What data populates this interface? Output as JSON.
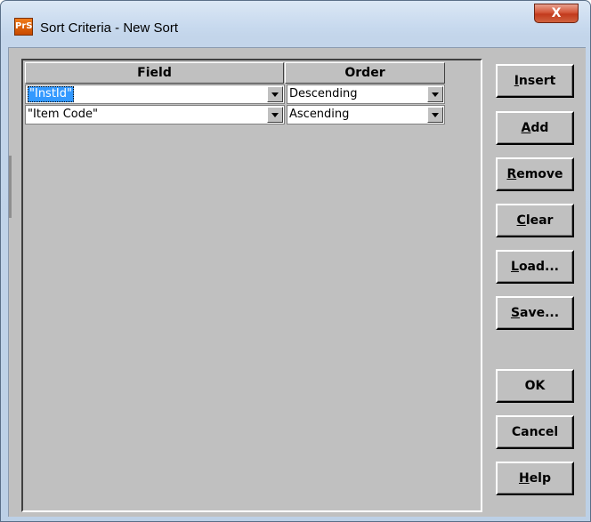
{
  "window": {
    "title": "Sort Criteria - New Sort",
    "icon_text": "PrS",
    "close_glyph": "X"
  },
  "grid": {
    "columns": [
      "Field",
      "Order"
    ],
    "rows": [
      {
        "field": "\"InstId\"",
        "order": "Descending",
        "selected": true
      },
      {
        "field": "\"Item Code\"",
        "order": "Ascending",
        "selected": false
      }
    ]
  },
  "buttons": [
    {
      "key": "insert",
      "label": "Insert",
      "mnemonic_index": 0
    },
    {
      "key": "add",
      "label": "Add",
      "mnemonic_index": 0
    },
    {
      "key": "remove",
      "label": "Remove",
      "mnemonic_index": 0
    },
    {
      "key": "clear",
      "label": "Clear",
      "mnemonic_index": 0
    },
    {
      "key": "load",
      "label": "Load...",
      "mnemonic_index": 0
    },
    {
      "key": "save",
      "label": "Save...",
      "mnemonic_index": 0
    },
    {
      "key": "ok",
      "label": "OK",
      "mnemonic_index": -1
    },
    {
      "key": "cancel",
      "label": "Cancel",
      "mnemonic_index": -1
    },
    {
      "key": "help",
      "label": "Help",
      "mnemonic_index": 0
    }
  ],
  "colors": {
    "selection": "#3399ff",
    "face": "#c0c0c0",
    "close_button": "#c23a1d"
  }
}
